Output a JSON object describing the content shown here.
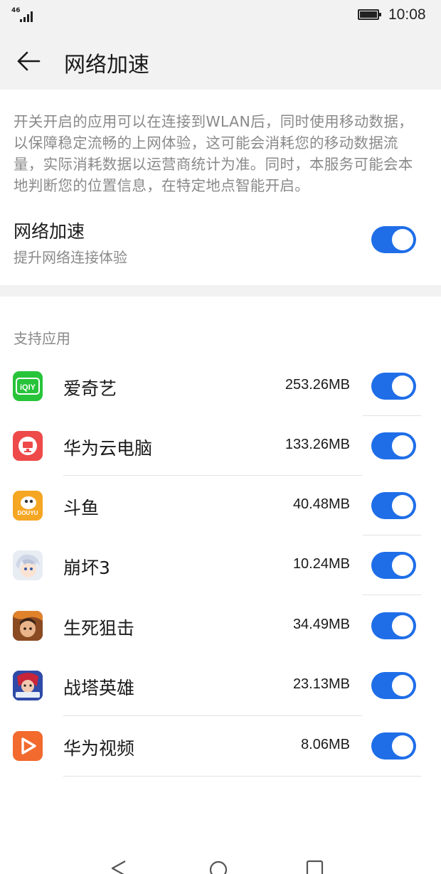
{
  "status_bar": {
    "network": "46",
    "time": "10:08"
  },
  "header": {
    "title": "网络加速"
  },
  "description": "开关开启的应用可以在连接到WLAN后，同时使用移动数据，以保障稳定流畅的上网体验，这可能会消耗您的移动数据流量，实际消耗数据以运营商统计为准。同时，本服务可能会本地判断您的位置信息，在特定地点智能开启。",
  "master": {
    "title": "网络加速",
    "subtitle": "提升网络连接体验",
    "enabled": true
  },
  "section_label": "支持应用",
  "apps": [
    {
      "name": "爱奇艺",
      "usage": "253.26MB",
      "enabled": true,
      "icon": "iqiyi-icon",
      "icon_text": "iQIY"
    },
    {
      "name": "华为云电脑",
      "usage": "133.26MB",
      "enabled": true,
      "icon": "huawei-cloud-pc-icon"
    },
    {
      "name": "斗鱼",
      "usage": "40.48MB",
      "enabled": true,
      "icon": "douyu-icon",
      "icon_text": "DOUYU"
    },
    {
      "name": "崩坏3",
      "usage": "10.24MB",
      "enabled": true,
      "icon": "honkai3-icon"
    },
    {
      "name": "生死狙击",
      "usage": "34.49MB",
      "enabled": true,
      "icon": "sheng-si-ju-ji-icon"
    },
    {
      "name": "战塔英雄",
      "usage": "23.13MB",
      "enabled": true,
      "icon": "zhan-ta-ying-xiong-icon"
    },
    {
      "name": "华为视频",
      "usage": "8.06MB",
      "enabled": true,
      "icon": "huawei-video-icon"
    }
  ],
  "colors": {
    "accent": "#1f6ee8",
    "header_bg": "#f2f2f2",
    "secondary_text": "#8a8a8a"
  }
}
